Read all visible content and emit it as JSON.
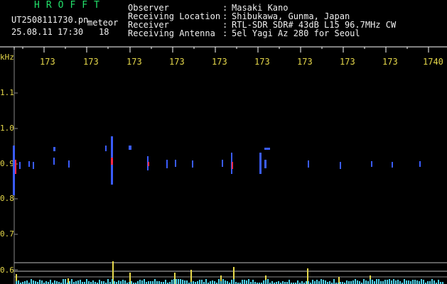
{
  "header": {
    "app_title": "HROFFT",
    "file_name": "UT2508111730.pn",
    "meteor_label": "meteor",
    "date_time": "25.08.11 17:30",
    "count": "18"
  },
  "info": [
    {
      "label": "Observer",
      "value": "Masaki Kano"
    },
    {
      "label": "Receiving Location",
      "value": "Shibukawa, Gunma, Japan"
    },
    {
      "label": "Receiver",
      "value": "RTL-SDR SDR# 43dB L15 96.7MHz CW"
    },
    {
      "label": "Receiving Antenna",
      "value": "5el Yagi Az 280 for Seoul"
    }
  ],
  "time_axis": {
    "labels": [
      "173",
      "173",
      "173",
      "173",
      "173",
      "173",
      "173",
      "173",
      "173",
      "1740"
    ]
  },
  "freq_axis": {
    "unit": "kHz",
    "labels": [
      "1.1",
      "1.0",
      "0.9",
      "0.8",
      "0.7",
      "0.6"
    ]
  },
  "colors": {
    "header_text": "#f0f0f0",
    "title_text": "#22e06a",
    "axis_text": "#e6d84a",
    "signal_blue": "#3a5cff",
    "signal_red": "#ff2a4a",
    "counter_bars": "#e6d84a",
    "counter_base": "#4fd0e6"
  }
}
